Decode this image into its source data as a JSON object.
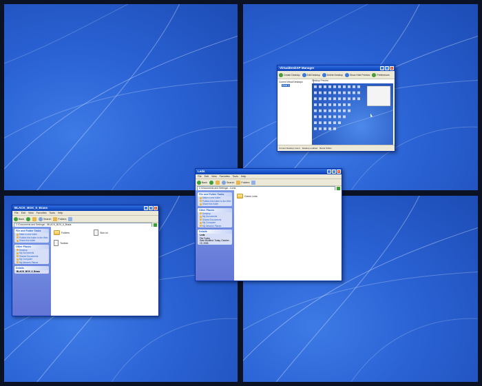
{
  "quadrants": [
    "top-left",
    "top-right",
    "bottom-left",
    "bottom-right"
  ],
  "colors": {
    "desktop_blue": "#2a62d4",
    "titlebar_blue": "#0a3fb5",
    "panel_blue": "#d6dff7",
    "border": "#0b1224"
  },
  "manager": {
    "title": "VirtualDeskXP Manager",
    "toolbar": [
      {
        "label": "Create Desktop",
        "icon": "monitor-icon"
      },
      {
        "label": "Edit Desktop",
        "icon": "edit-icon"
      },
      {
        "label": "Delete Desktop",
        "icon": "delete-icon"
      },
      {
        "label": "Show Hide Preview",
        "icon": "preview-icon"
      },
      {
        "label": "Preferences",
        "icon": "gear-icon"
      }
    ],
    "tree_root": "Current Virtual Desktops",
    "tree_item": "Desk 4",
    "preview_label": "Desktop Preview",
    "status_left": "Current Desktop Count",
    "status_mid": "Desktop enabled",
    "status_right": "Barrel Shifter"
  },
  "win_bl": {
    "title": "BLACK_BOX_II_Brass",
    "menu": [
      "File",
      "Edit",
      "View",
      "Favorites",
      "Tools",
      "Help"
    ],
    "back": "Back",
    "search": "Search",
    "folders": "Folders",
    "address": "C:\\Documents and Settings\\...\\BLACK_BOX_II_Brass",
    "tasks_title": "File and Folder Tasks",
    "tasks": [
      "Make a new folder",
      "Publish this folder to the Web",
      "Share this folder"
    ],
    "places_title": "Other Places",
    "places": [
      "Desktop",
      "My Documents",
      "Shared Documents",
      "My Computer",
      "My Network Places"
    ],
    "details_title": "Details",
    "details_name": "BLACK_BOX_II_Brass",
    "files": [
      {
        "name": "Folders",
        "type": "folder"
      },
      {
        "name": "Skin.ini",
        "type": "doc"
      },
      {
        "name": "Toolbar",
        "type": "doc"
      }
    ]
  },
  "win_center": {
    "title": "Leds",
    "menu": [
      "File",
      "Edit",
      "View",
      "Favorites",
      "Tools",
      "Help"
    ],
    "back": "Back",
    "search": "Search",
    "folders": "Folders",
    "address": "C:\\Documents and Settings\\...\\Leds",
    "tasks_title": "File and Folder Tasks",
    "tasks": [
      "Make a new folder",
      "Publish this folder to the Web",
      "Share this folder"
    ],
    "places_title": "Other Places",
    "places": [
      "Desktop",
      "My Documents",
      "Shared Documents",
      "My Computer",
      "My Network Places"
    ],
    "details_title": "Details",
    "details_name": "Leds",
    "details_type": "File Folder",
    "details_date": "Date Modified: Today, October 19, 2006",
    "files": [
      {
        "name": "Green Leds",
        "type": "folder"
      }
    ]
  }
}
